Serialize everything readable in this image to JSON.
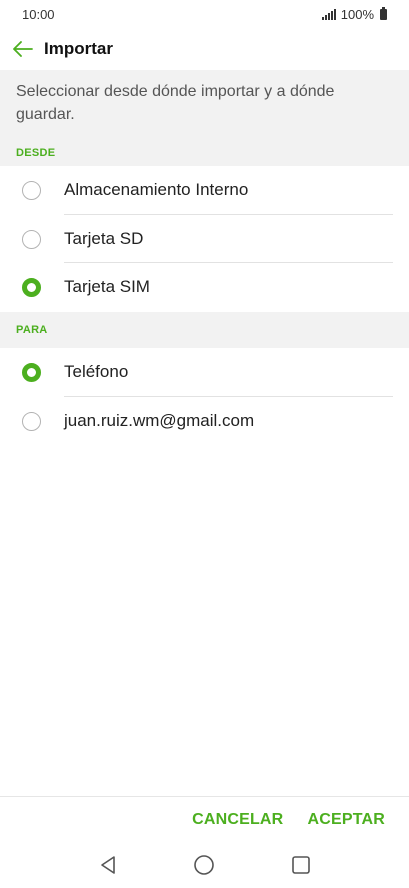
{
  "status_bar": {
    "time": "10:00",
    "battery": "100%"
  },
  "app_bar": {
    "title": "Importar"
  },
  "description": "Seleccionar desde dónde importar y a dónde guardar.",
  "sections": {
    "desde": {
      "header": "DESDE",
      "options": [
        {
          "label": "Almacenamiento Interno",
          "checked": false
        },
        {
          "label": "Tarjeta SD",
          "checked": false
        },
        {
          "label": "Tarjeta SIM",
          "checked": true
        }
      ]
    },
    "para": {
      "header": "PARA",
      "options": [
        {
          "label": "Teléfono",
          "checked": true
        },
        {
          "label": "juan.ruiz.wm@gmail.com",
          "checked": false
        }
      ]
    }
  },
  "actions": {
    "cancel": "CANCELAR",
    "accept": "ACEPTAR"
  },
  "colors": {
    "accent": "#4caf1f",
    "section_bg": "#f2f2f2"
  }
}
